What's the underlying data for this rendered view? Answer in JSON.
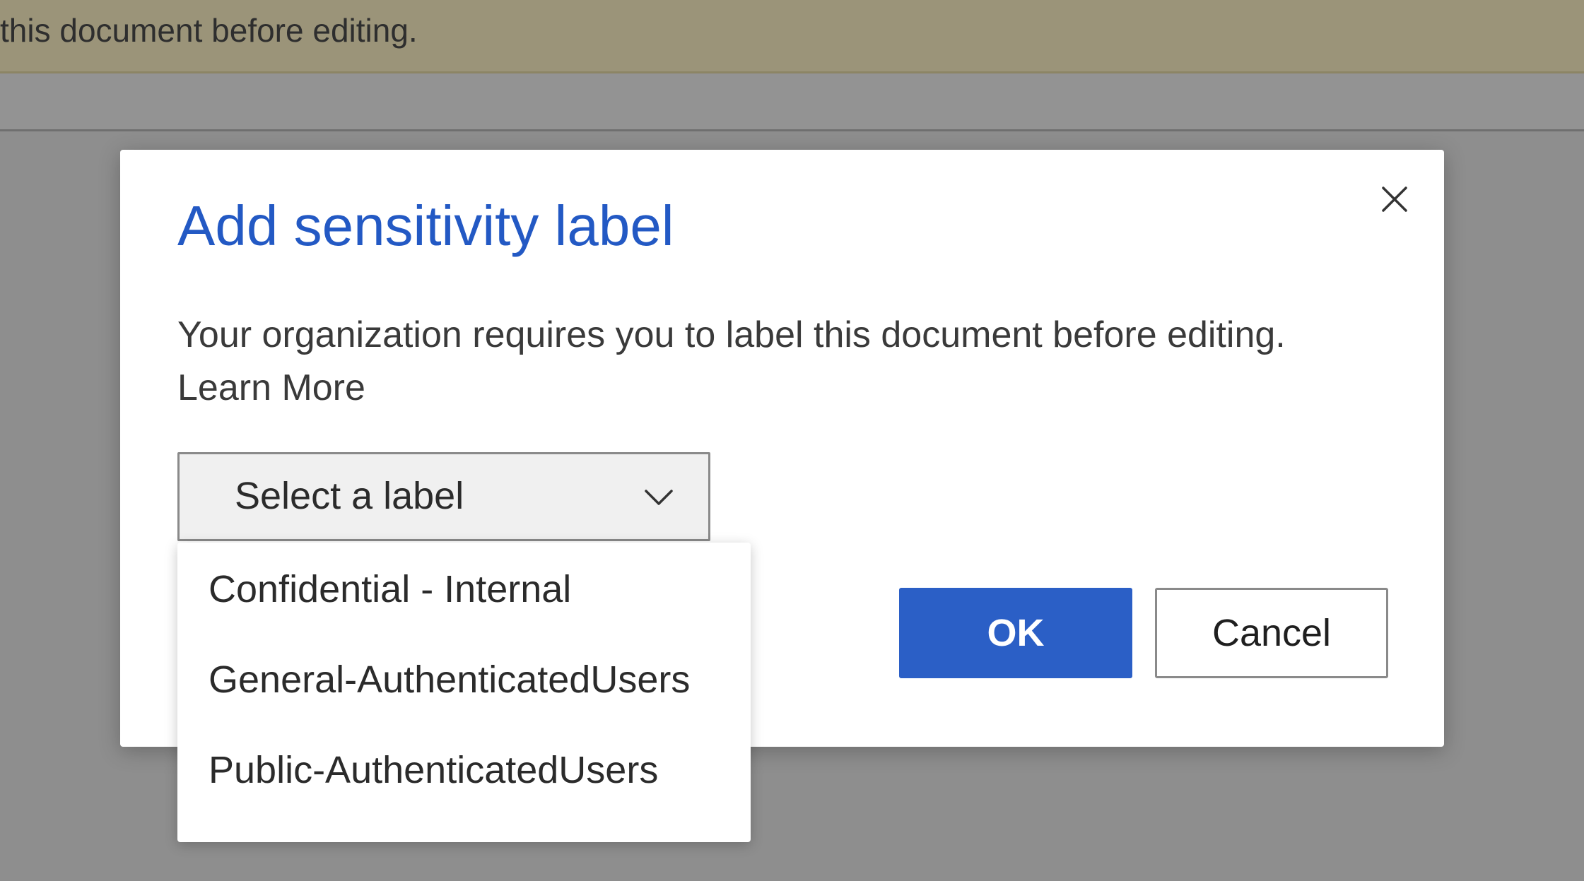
{
  "banner": {
    "text": "this document before editing."
  },
  "dialog": {
    "title": "Add sensitivity label",
    "message": "Your organization requires you to label this document before editing.",
    "learn_more": "Learn More",
    "close_icon": "close-icon",
    "select": {
      "value": "Select a label",
      "icon": "chevron-down-icon",
      "options": [
        {
          "label": "Confidential - Internal"
        },
        {
          "label": "General-AuthenticatedUsers"
        },
        {
          "label": "Public-AuthenticatedUsers"
        }
      ]
    },
    "ok_label": "OK",
    "cancel_label": "Cancel"
  },
  "colors": {
    "accent": "#2b5fc6",
    "title": "#2359c4",
    "banner": "#9b9479",
    "backdrop": "#8e8e8e"
  }
}
